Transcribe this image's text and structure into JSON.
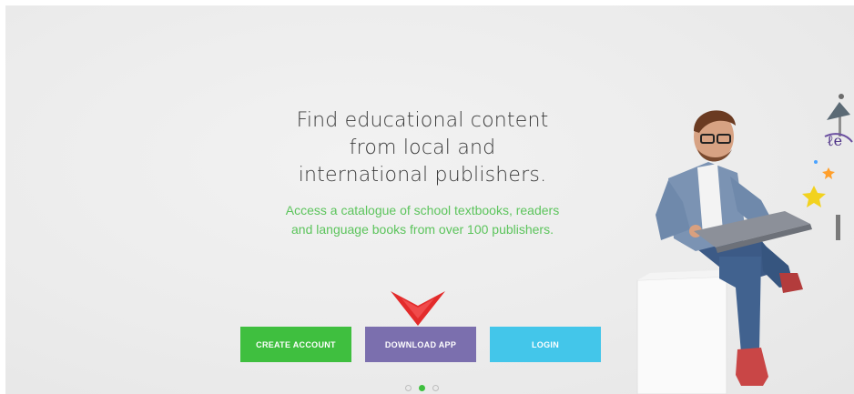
{
  "hero": {
    "headline_lines": [
      "Find educational content",
      "from local and",
      "international publishers."
    ],
    "subline_lines": [
      "Access a catalogue of school textbooks, readers",
      "and language books from over 100 publishers."
    ]
  },
  "buttons": {
    "create_account": "CREATE ACCOUNT",
    "download_app": "DOWNLOAD APP",
    "login": "LOGIN"
  },
  "carousel": {
    "slide_count": 3,
    "active_index": 1
  },
  "colors": {
    "create_account": "#3fbf3f",
    "download_app": "#7b6fae",
    "login": "#43c6ea",
    "subline": "#5cc45c",
    "pointer": "#e32b2b"
  },
  "illustration": {
    "subject": "person-with-laptop-illustration"
  }
}
